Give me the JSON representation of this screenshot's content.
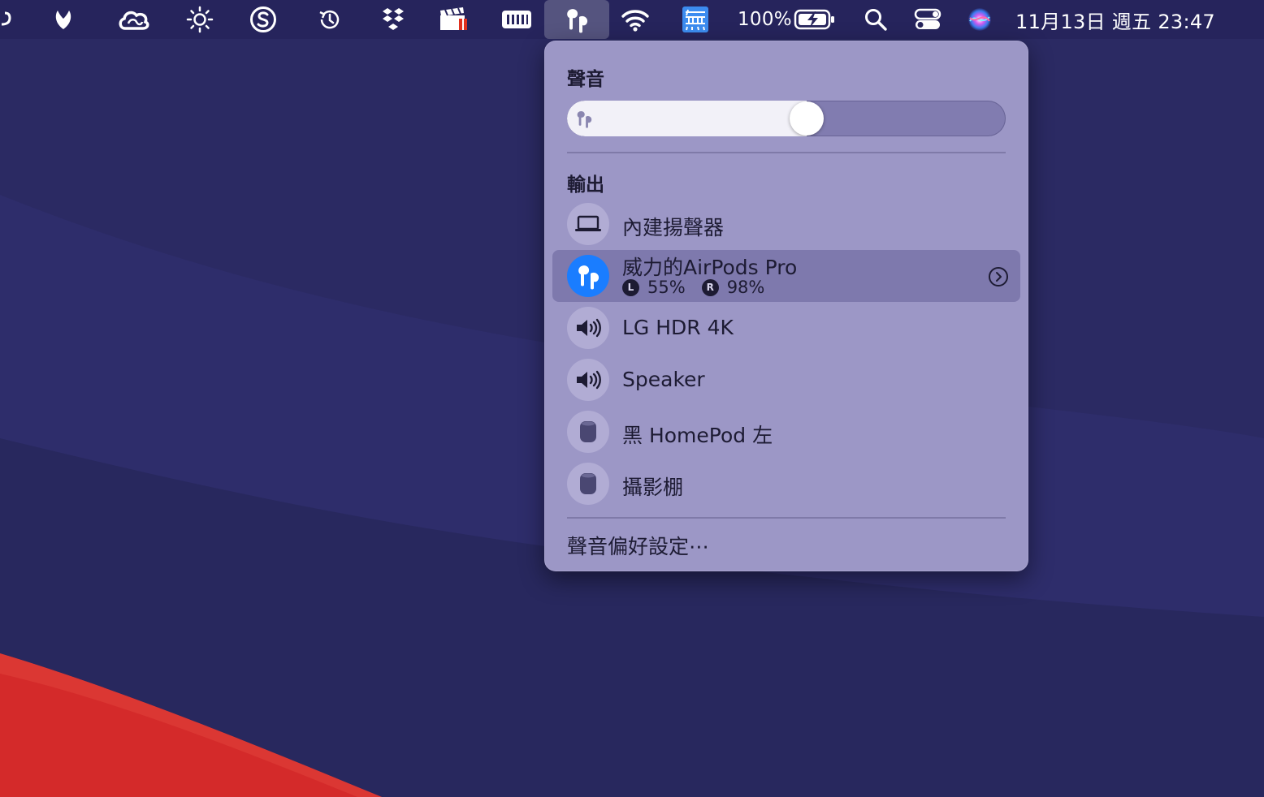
{
  "menubar": {
    "battery_percent": "100%",
    "clock": "11月13日 週五  23:47"
  },
  "sound_panel": {
    "title": "聲音",
    "volume_level": 0.55,
    "output_heading": "輸出",
    "devices": [
      {
        "name": "內建揚聲器",
        "icon": "laptop-icon",
        "selected": false
      },
      {
        "name": "威力的AirPods Pro",
        "icon": "airpods-icon",
        "selected": true,
        "battery": {
          "left_badge": "L",
          "left_value": "55%",
          "right_badge": "R",
          "right_value": "98%"
        }
      },
      {
        "name": "LG HDR 4K",
        "icon": "speaker-icon",
        "selected": false
      },
      {
        "name": "Speaker",
        "icon": "speaker-icon",
        "selected": false
      },
      {
        "name": "黑 HomePod 左",
        "icon": "homepod-icon",
        "selected": false
      },
      {
        "name": "攝影棚",
        "icon": "homepod-icon",
        "selected": false
      }
    ],
    "preferences_label": "聲音偏好設定⋯"
  },
  "colors": {
    "panel_bg": "#9c97c6",
    "selected_row": "#7e79ad",
    "accent_blue": "#1a7dff",
    "wallpaper_base": "#2a2a62",
    "wallpaper_red": "#d42a2a"
  }
}
